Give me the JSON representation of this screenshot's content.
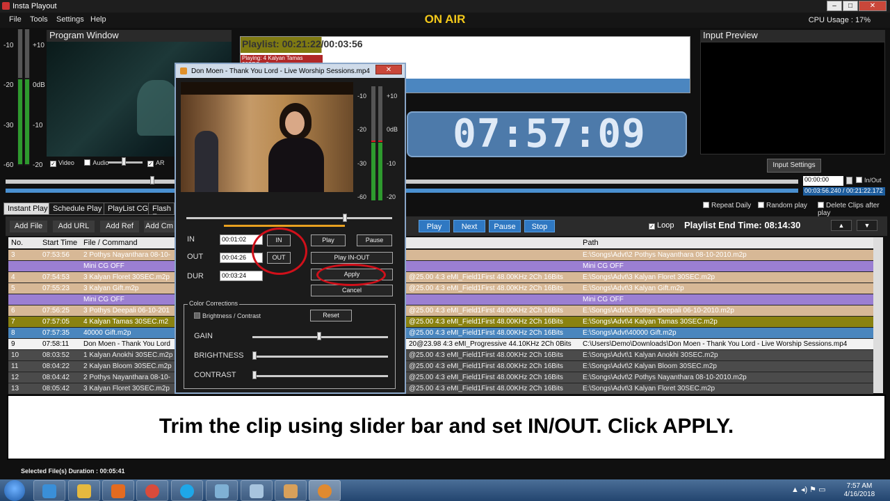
{
  "window": {
    "title": "Insta Playout",
    "minimize": "–",
    "maximize": "□",
    "close": "✕"
  },
  "menu": [
    "File",
    "Tools",
    "Settings",
    "Help"
  ],
  "on_air": "ON AIR",
  "cpu_usage": "CPU Usage : 17%",
  "program_window": {
    "title": "Program Window",
    "meter_labels_left": [
      "-10",
      "-20",
      "-30",
      "-60"
    ],
    "meter_labels_right": [
      "+10",
      "0dB",
      "-10",
      "-20"
    ],
    "options": [
      "Video",
      "Audio",
      "AR"
    ]
  },
  "playlist": {
    "header": "Playlist: 00:21:22/00:03:56",
    "playing": "Playing: 4 Kalyan Tamas 30SEC.m2p"
  },
  "clock": "07:57:09",
  "input_preview": {
    "title": "Input Preview",
    "settings_button": "Input Settings"
  },
  "timecodes": {
    "in_field": "00:00:00",
    "in_out_label": "In/Out",
    "duration": "00:03:56.240 / 00:21:22.172"
  },
  "tabs": [
    "Instant Play",
    "Schedule Play",
    "PlayList CG",
    "Flash F"
  ],
  "options": {
    "repeat_daily": "Repeat Daily",
    "random_play": "Random play",
    "delete_clips": "Delete Clips after play"
  },
  "toolbar": {
    "add_file": "Add File",
    "add_url": "Add URL",
    "add_ref": "Add Ref",
    "add_cmd": "Add Cm",
    "play": "Play",
    "next": "Next",
    "pause": "Pause",
    "stop": "Stop",
    "loop": "Loop",
    "playlist_end_time": "Playlist End Time: 08:14:30",
    "up": "▲",
    "down": "▼"
  },
  "table": {
    "columns": [
      "No.",
      "Start Time",
      "File / Command",
      "Path"
    ],
    "rows": [
      {
        "no": "3",
        "start": "07:53:56",
        "file": "2 Pothys Nayanthara 08-10-",
        "info": "",
        "path": "E:\\Songs\\Advt\\2 Pothys Nayanthara 08-10-2010.m2p",
        "style": "tan"
      },
      {
        "no": "",
        "start": "",
        "file": "Mini CG OFF",
        "info": "",
        "path": "Mini CG OFF",
        "style": "purple"
      },
      {
        "no": "4",
        "start": "07:54:53",
        "file": "3 Kalyan Floret 30SEC.m2p",
        "info": "@25.00 4:3 eMI_Field1First 48.00KHz 2Ch 16Bits",
        "path": "E:\\Songs\\Advt\\3 Kalyan Floret 30SEC.m2p",
        "style": "tan"
      },
      {
        "no": "5",
        "start": "07:55:23",
        "file": "3 Kalyan Gift.m2p",
        "info": "@25.00 4:3 eMI_Field1First 48.00KHz 2Ch 16Bits",
        "path": "E:\\Songs\\Advt\\3 Kalyan Gift.m2p",
        "style": "tan"
      },
      {
        "no": "",
        "start": "",
        "file": "Mini CG OFF",
        "info": "",
        "path": "Mini CG OFF",
        "style": "purple"
      },
      {
        "no": "6",
        "start": "07:56:25",
        "file": "3 Pothys Deepali 06-10-201",
        "info": "@25.00 4:3 eMI_Field1First 48.00KHz 2Ch 16Bits",
        "path": "E:\\Songs\\Advt\\3 Pothys Deepali 06-10-2010.m2p",
        "style": "tan"
      },
      {
        "no": "7",
        "start": "07:57:05",
        "file": "4 Kalyan Tamas 30SEC.m2",
        "info": "@25.00 4:3 eMI_Field1First 48.00KHz 2Ch 16Bits",
        "path": "E:\\Songs\\Advt\\4 Kalyan Tamas 30SEC.m2p",
        "style": "olive"
      },
      {
        "no": "8",
        "start": "07:57:35",
        "file": "40000 Gift.m2p",
        "info": "@25.00 4:3 eMI_Field1First 48.00KHz 2Ch 16Bits",
        "path": "E:\\Songs\\Advt\\40000 Gift.m2p",
        "style": "blue"
      },
      {
        "no": "9",
        "start": "07:58:11",
        "file": "Don Moen - Thank You Lord",
        "info": "20@23.98 4:3 eMI_Progressive 44.10KHz 2Ch 0Bits",
        "path": "C:\\Users\\Demo\\Downloads\\Don Moen - Thank You Lord - Live Worship Sessions.mp4",
        "style": "white"
      },
      {
        "no": "10",
        "start": "08:03:52",
        "file": "1 Kalyan Anokhi 30SEC.m2p",
        "info": "@25.00 4:3 eMI_Field1First 48.00KHz 2Ch 16Bits",
        "path": "E:\\Songs\\Advt\\1 Kalyan Anokhi 30SEC.m2p",
        "style": "gray"
      },
      {
        "no": "11",
        "start": "08:04:22",
        "file": "2 Kalyan Bloom 30SEC.m2p",
        "info": "@25.00 4:3 eMI_Field1First 48.00KHz 2Ch 16Bits",
        "path": "E:\\Songs\\Advt\\2 Kalyan Bloom 30SEC.m2p",
        "style": "gray"
      },
      {
        "no": "12",
        "start": "08:04:42",
        "file": "2 Pothys Nayanthara 08-10-",
        "info": "@25.00 4:3 eMI_Field1First 48.00KHz 2Ch 16Bits",
        "path": "E:\\Songs\\Advt\\2 Pothys Nayanthara 08-10-2010.m2p",
        "style": "gray"
      },
      {
        "no": "13",
        "start": "08:05:42",
        "file": "3 Kalyan Floret 30SEC.m2p",
        "info": "@25.00 4:3 eMI_Field1First 48.00KHz 2Ch 16Bits",
        "path": "E:\\Songs\\Advt\\3 Kalyan Floret 30SEC.m2p",
        "style": "gray"
      }
    ]
  },
  "dialog": {
    "title": "Don Moen - Thank You Lord - Live Worship Sessions.mp4",
    "close": "✕",
    "meter_labels_left": [
      "-10",
      "-20",
      "-30",
      "-60"
    ],
    "meter_labels_right": [
      "+10",
      "0dB",
      "-10",
      "-20"
    ],
    "in_label": "IN",
    "out_label": "OUT",
    "dur_label": "DUR",
    "in_value": "00:01:02",
    "out_value": "00:04:26",
    "dur_value": "00:03:24",
    "in_button": "IN",
    "out_button": "OUT",
    "play": "Play",
    "pause": "Pause",
    "play_in_out": "Play IN-OUT",
    "apply": "Apply",
    "cancel": "Cancel",
    "color_corrections": "Color Corrections",
    "brightness_contrast": "Brightness / Contrast",
    "reset": "Reset",
    "gain": "GAIN",
    "brightness": "BRIGHTNESS",
    "contrast": "CONTRAST"
  },
  "caption": "Trim the clip using slider bar and set IN/OUT. Click APPLY.",
  "status": "Selected File(s) Duration : 00:05:41",
  "tray": {
    "time": "7:57 AM",
    "date": "4/16/2018"
  },
  "colors": {
    "accent_yellow": "#f2c81a",
    "on_air": "#f2c81a",
    "clock_blue": "#4d7aaa",
    "highlight_red": "#d0101a"
  }
}
